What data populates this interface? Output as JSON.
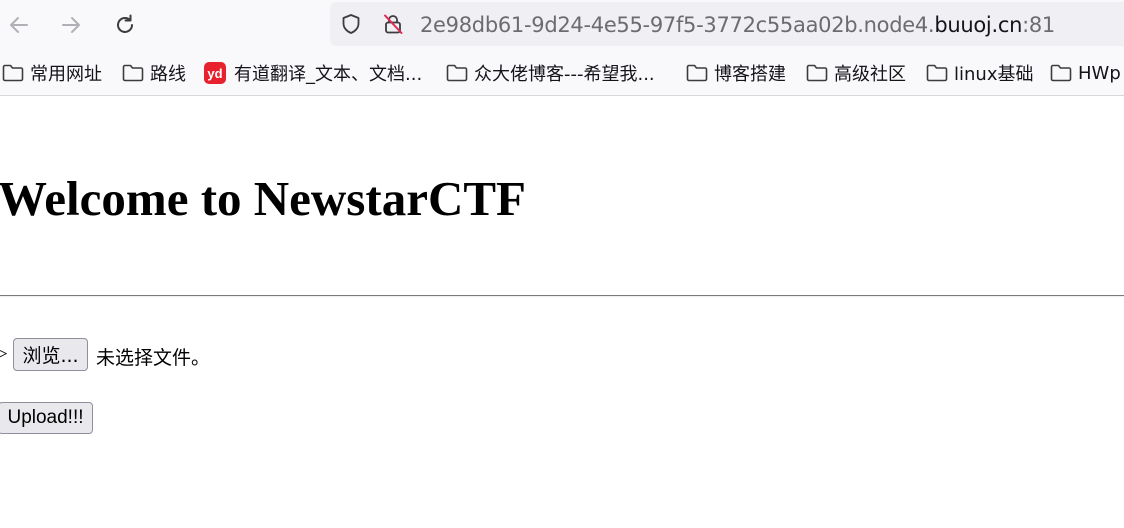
{
  "browser": {
    "url_prefix": "2e98db61-9d24-4e55-97f5-3772c55aa02b.node4.",
    "url_host": "buuoj.cn",
    "url_suffix": ":81",
    "icons": {
      "back": "arrow-left-icon",
      "forward": "arrow-right-icon",
      "reload": "reload-icon",
      "tracking": "shield-icon",
      "insecure": "insecure-lock-icon"
    }
  },
  "bookmarks": [
    {
      "label": "常用网址",
      "icon": "folder-icon"
    },
    {
      "label": "路线",
      "icon": "folder-icon"
    },
    {
      "label": "有道翻译_文本、文档...",
      "icon": "youdao-icon",
      "badge": "yd"
    },
    {
      "label": "众大佬博客---希望我...",
      "icon": "folder-icon"
    },
    {
      "label": "博客搭建",
      "icon": "folder-icon"
    },
    {
      "label": "高级社区",
      "icon": "folder-icon"
    },
    {
      "label": "linux基础",
      "icon": "folder-icon"
    },
    {
      "label": "HWp",
      "icon": "folder-icon"
    }
  ],
  "page": {
    "heading": "Welcome to NewstarCTF",
    "stray_char": ">",
    "browse_label": "浏览...",
    "file_status": "未选择文件。",
    "upload_label": "Upload!!!"
  },
  "colors": {
    "youdao_red": "#e8212e",
    "insecure_red": "#e22850"
  }
}
